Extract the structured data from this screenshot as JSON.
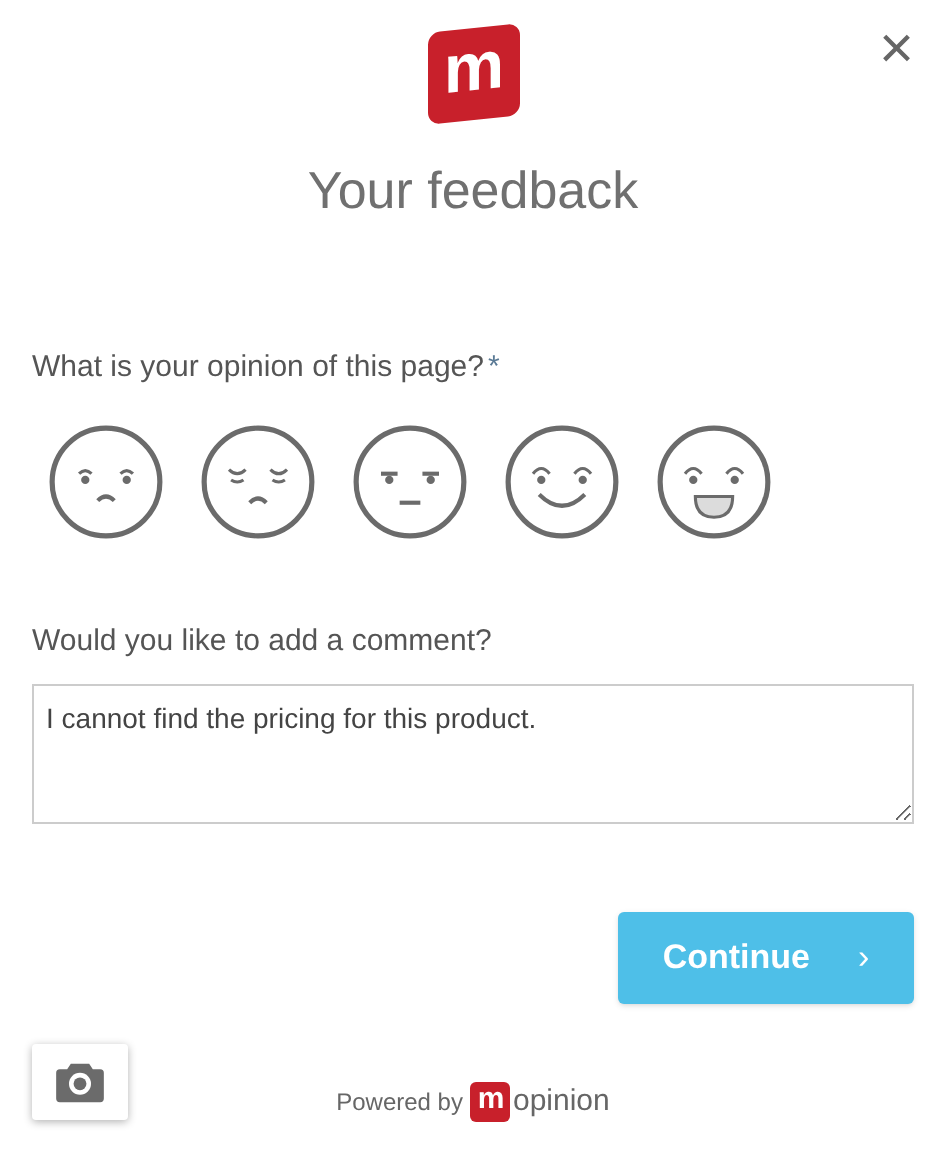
{
  "header": {
    "logo_letter": "m",
    "title": "Your feedback",
    "close": "×"
  },
  "rating": {
    "question": "What is your opinion of this page?",
    "required_mark": "*",
    "faces": [
      {
        "kind": "sad"
      },
      {
        "kind": "tired"
      },
      {
        "kind": "neutral"
      },
      {
        "kind": "happy"
      },
      {
        "kind": "laughing"
      }
    ]
  },
  "comment": {
    "label": "Would you like to add a comment?",
    "value": "I cannot find the pricing for this product."
  },
  "continue_button": {
    "label": "Continue",
    "chevron": "›"
  },
  "footer": {
    "powered_by": "Powered by",
    "brand_letter": "m",
    "brand_rest": "opinion"
  }
}
